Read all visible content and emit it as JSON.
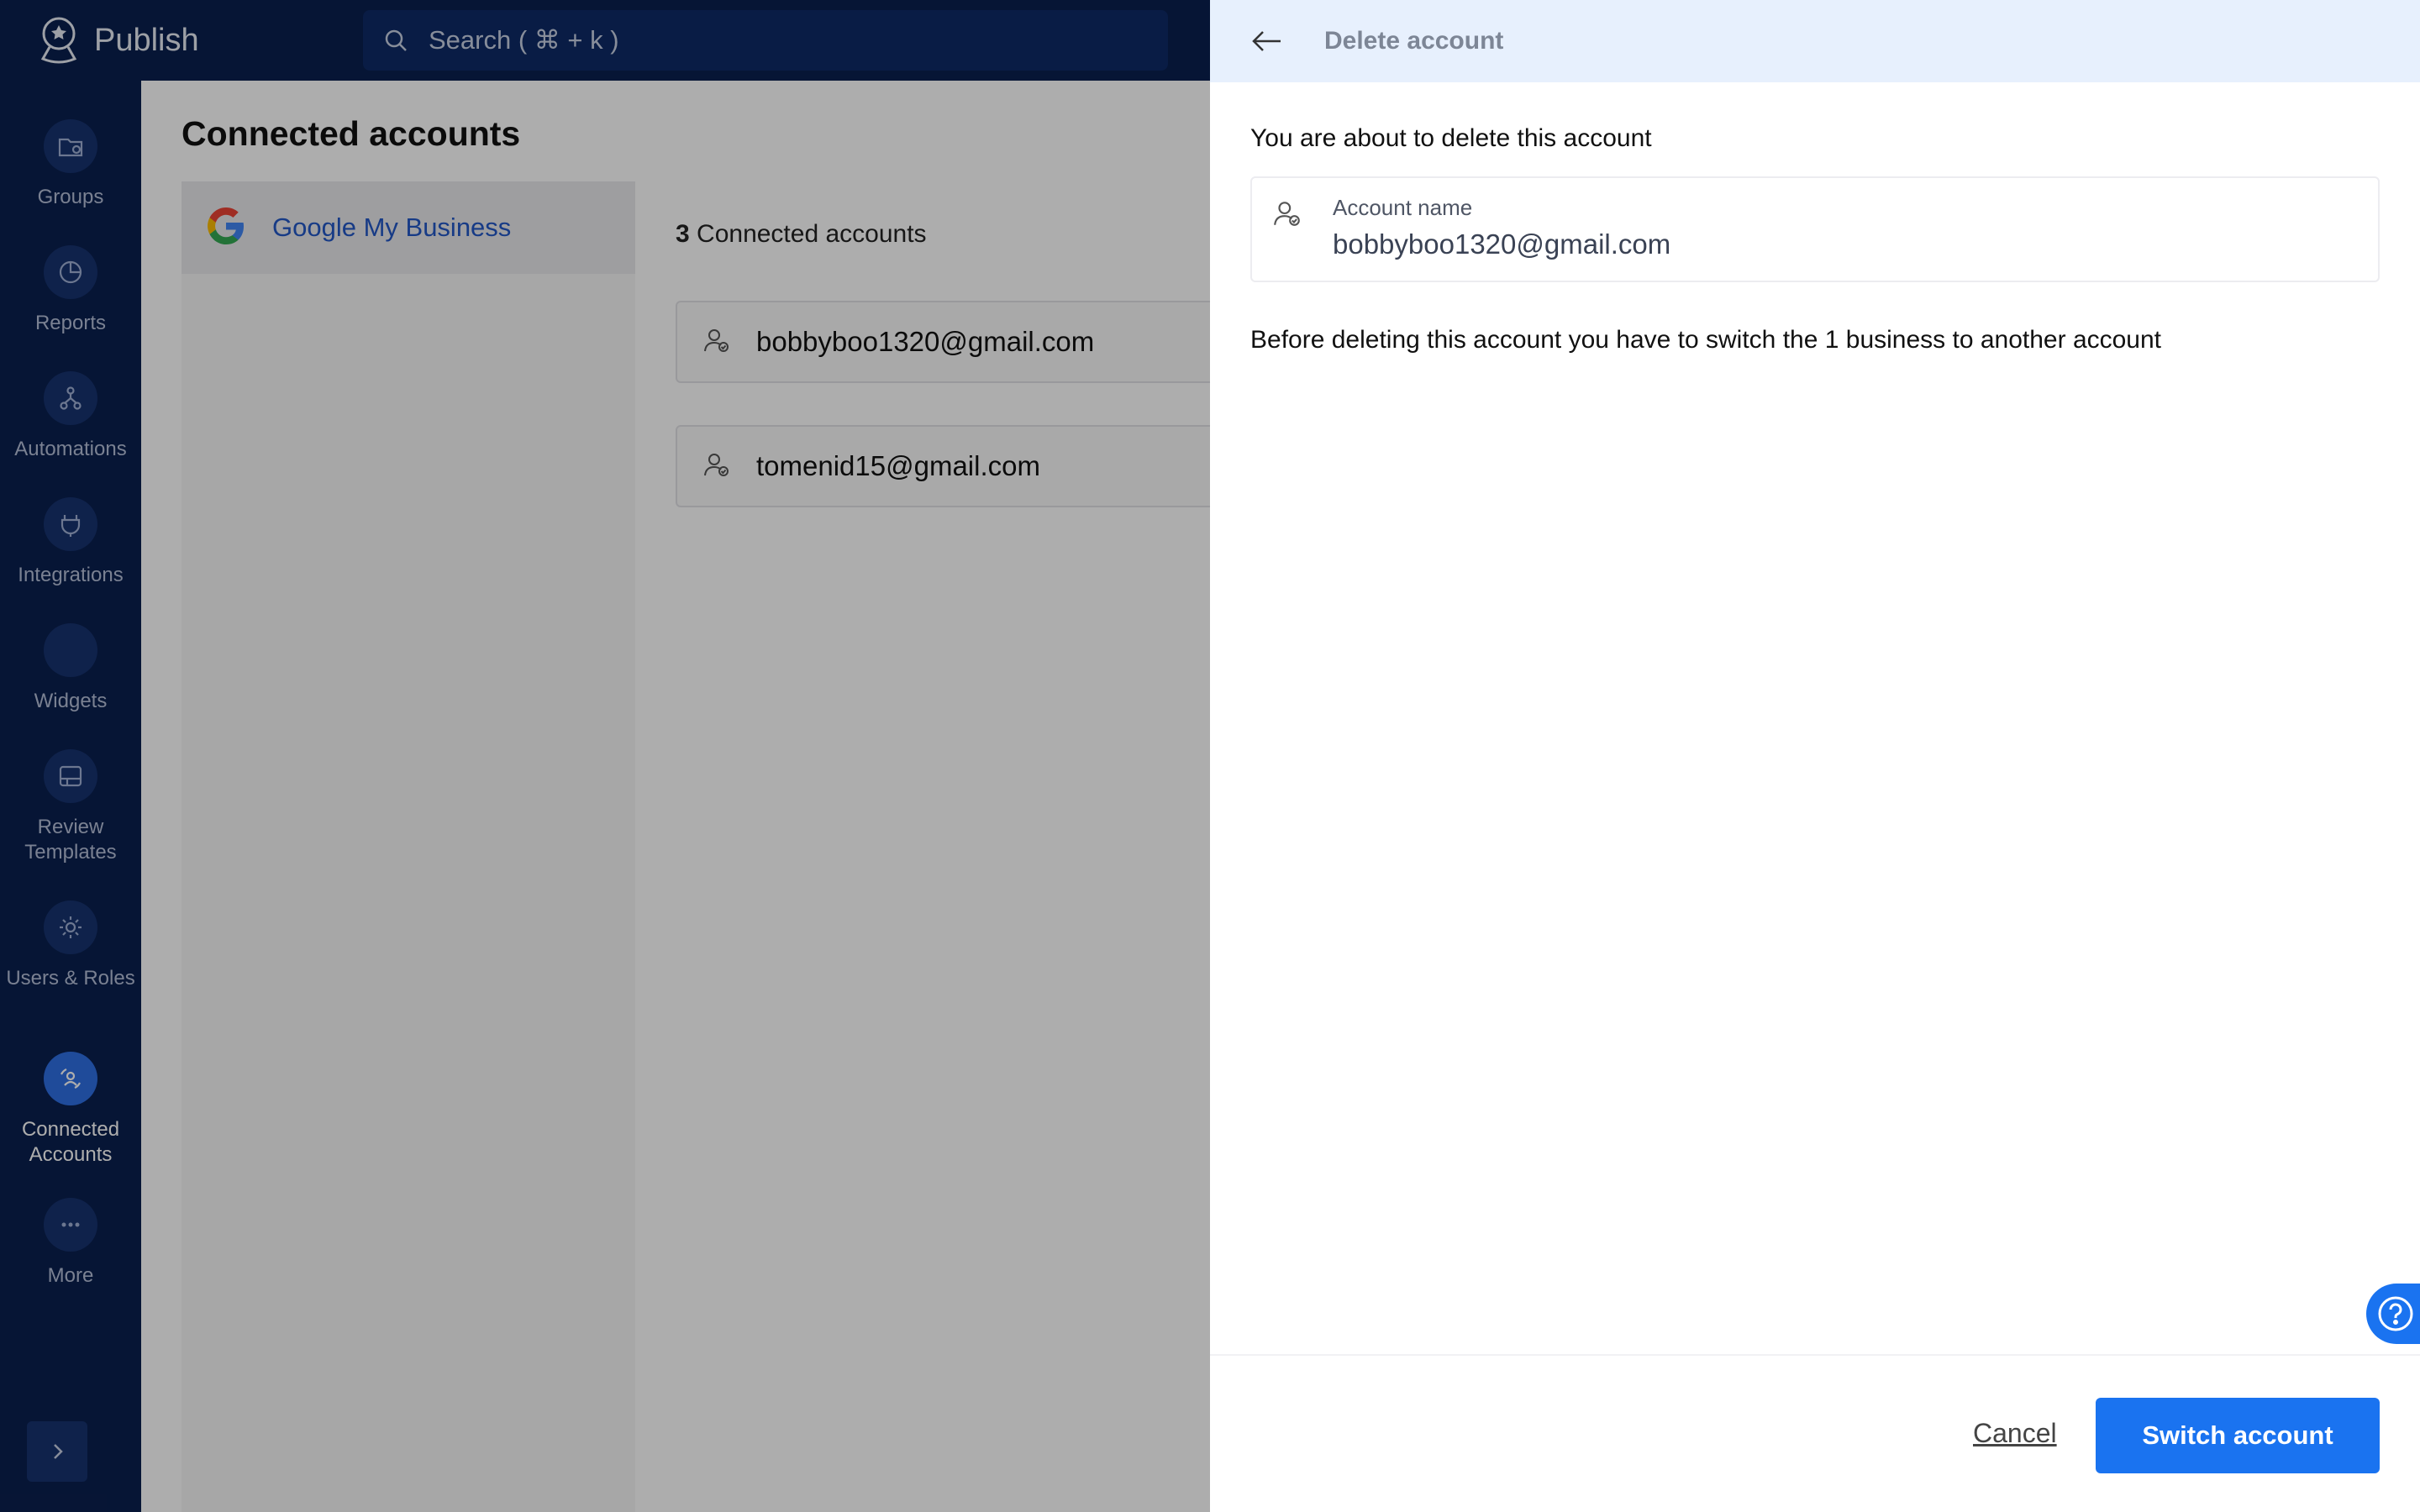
{
  "app": {
    "name": "Publish"
  },
  "search": {
    "placeholder": "Search ( ⌘ + k )"
  },
  "sidebar": {
    "items": [
      {
        "label": "Groups",
        "icon": "groups-icon"
      },
      {
        "label": "Reports",
        "icon": "reports-icon"
      },
      {
        "label": "Automations",
        "icon": "automations-icon"
      },
      {
        "label": "Integrations",
        "icon": "integrations-icon"
      },
      {
        "label": "Widgets",
        "icon": "widgets-icon"
      },
      {
        "label": "Review Templates",
        "icon": "review-templates-icon"
      },
      {
        "label": "Users & Roles",
        "icon": "users-roles-icon"
      },
      {
        "label": "Connected Accounts",
        "icon": "connected-accounts-icon",
        "active": true
      },
      {
        "label": "More",
        "icon": "more-icon"
      }
    ]
  },
  "main": {
    "title": "Connected accounts",
    "provider": "Google My Business",
    "count": "3",
    "count_suffix": "Connected accounts",
    "accounts": [
      {
        "email": "bobbyboo1320@gmail.com"
      },
      {
        "email": "tomenid15@gmail.com"
      }
    ]
  },
  "drawer": {
    "title": "Delete account",
    "intro": "You are about to delete this account",
    "account_label": "Account name",
    "account_value": "bobbyboo1320@gmail.com",
    "note": "Before deleting this account you have to switch the 1 business to another account",
    "cancel_label": "Cancel",
    "switch_label": "Switch account"
  },
  "colors": {
    "nav_bg": "#0a1f4e",
    "accent": "#1a73f0",
    "header_bg": "#e7f0fd",
    "link": "#2357c6"
  }
}
